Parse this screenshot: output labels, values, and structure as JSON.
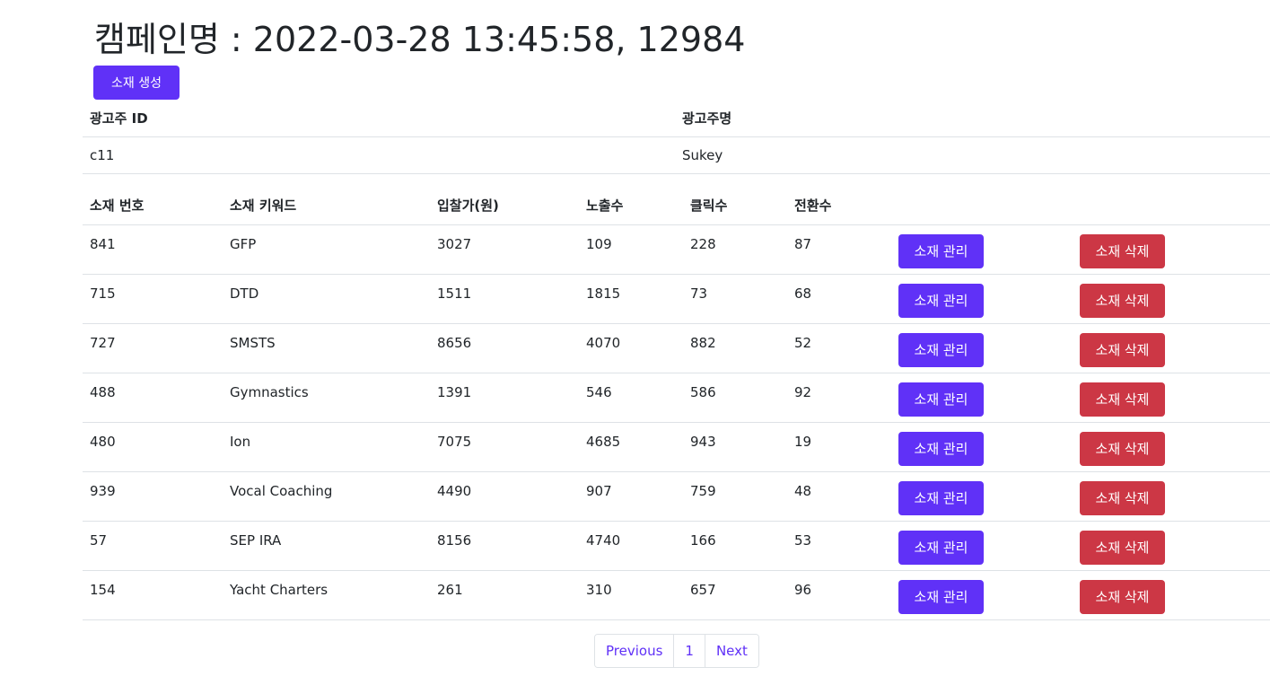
{
  "page": {
    "title": "캠페인명 : 2022-03-28 13:45:58, 12984"
  },
  "toolbar": {
    "create_label": "소재 생성"
  },
  "advertiser": {
    "headers": [
      "광고주 ID",
      "광고주명"
    ],
    "values": [
      "c11",
      "Sukey"
    ]
  },
  "creatives": {
    "headers": [
      "소재 번호",
      "소재 키워드",
      "입찰가(원)",
      "노출수",
      "클릭수",
      "전환수"
    ],
    "manage_label": "소재 관리",
    "delete_label": "소재 삭제",
    "rows": [
      [
        "841",
        "GFP",
        "3027",
        "109",
        "228",
        "87"
      ],
      [
        "715",
        "DTD",
        "1511",
        "1815",
        "73",
        "68"
      ],
      [
        "727",
        "SMSTS",
        "8656",
        "4070",
        "882",
        "52"
      ],
      [
        "488",
        "Gymnastics",
        "1391",
        "546",
        "586",
        "92"
      ],
      [
        "480",
        "Ion",
        "7075",
        "4685",
        "943",
        "19"
      ],
      [
        "939",
        "Vocal Coaching",
        "4490",
        "907",
        "759",
        "48"
      ],
      [
        "57",
        "SEP IRA",
        "8156",
        "4740",
        "166",
        "53"
      ],
      [
        "154",
        "Yacht Charters",
        "261",
        "310",
        "657",
        "96"
      ]
    ]
  },
  "pagination": {
    "previous_label": "Previous",
    "current_page": "1",
    "next_label": "Next"
  },
  "colors": {
    "primary": "#6031f7",
    "danger": "#cc3745",
    "border": "#dee2e6",
    "text": "#212529"
  }
}
